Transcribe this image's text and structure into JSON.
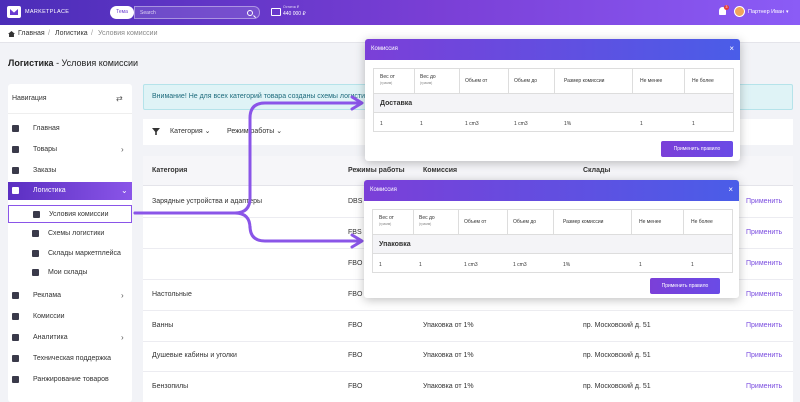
{
  "topbar": {
    "brand": "MARKETPLACE",
    "theme_chip": "Тема",
    "search_placeholder": "Search",
    "balance_label": "Остаток ₽",
    "balance_value": "440 000 ₽",
    "notification_count": "3",
    "user_name": "Партнер Иван",
    "user_caret": "▾"
  },
  "breadcrumbs": {
    "home": "Главная",
    "logistics": "Логистика",
    "current": "Условия комиссии",
    "sep": "/"
  },
  "page_title": {
    "section": "Логистика",
    "rest": " - Условия комиссии"
  },
  "sidebar": {
    "title": "Навигация",
    "toggle_icon": "⇄",
    "chevron": "›",
    "chevron_open": "⌄",
    "items": [
      {
        "label": "Главная"
      },
      {
        "label": "Товары"
      },
      {
        "label": "Заказы"
      },
      {
        "label": "Логистика"
      },
      {
        "label": "Реклама"
      },
      {
        "label": "Комиссии"
      },
      {
        "label": "Аналитика"
      },
      {
        "label": "Техническая поддержка"
      },
      {
        "label": "Ранжирование товаров"
      }
    ],
    "sub_items": [
      {
        "label": "Условия комиссии"
      },
      {
        "label": "Схемы логистики"
      },
      {
        "label": "Склады маркетплейса"
      },
      {
        "label": "Мои склады"
      }
    ]
  },
  "alert": {
    "text": "Внимание! Не для всех категорий товара созданы схемы логистики"
  },
  "filters": {
    "category": "Категория ⌄",
    "modes": "Режим работы ⌄"
  },
  "table": {
    "headers": {
      "category": "Категория",
      "modes": "Режимы работы",
      "commission": "Комиссия",
      "warehouses": "Склады"
    },
    "rows": [
      {
        "category": "Зарядные устройства и адаптеры",
        "mode": "DBS"
      },
      {
        "mode": "FBS"
      },
      {
        "mode": "FBO"
      },
      {
        "category": "Настольные",
        "mode": "FBO"
      },
      {
        "category": "Ванны",
        "mode": "FBO",
        "commission": "Упаковка от 1%",
        "warehouse": "пр. Московский д. 51"
      },
      {
        "category": "Душевые кабины и уголки",
        "mode": "FBO",
        "commission": "Упаковка от 1%",
        "warehouse": "пр. Московский д. 51"
      },
      {
        "category": "Бензопилы",
        "mode": "FBO",
        "commission": "Упаковка от 1%",
        "warehouse": "пр. Московский д. 51"
      }
    ],
    "apply_label": "Применить"
  },
  "modals": [
    {
      "title": "Комиссия",
      "close": "×",
      "headers": [
        "Вес от",
        "Вес до",
        "Объем от",
        "Объем до",
        "Размер комиссии",
        "Не менее",
        "Не более"
      ],
      "header_sub": "(грамм)",
      "section": "Доставка",
      "values": [
        "1",
        "1",
        "1 cm3",
        "1 cm3",
        "1%",
        "1",
        "1"
      ],
      "button": "Применить правило"
    },
    {
      "title": "Комиссия",
      "close": "×",
      "headers": [
        "Вес от",
        "Вес до",
        "Объем от",
        "Объем до",
        "Размер комиссии",
        "Не менее",
        "Не более"
      ],
      "header_sub": "(грамм)",
      "section": "Упаковка",
      "values": [
        "1",
        "1",
        "1 cm3",
        "1 cm3",
        "1%",
        "1",
        "1"
      ],
      "button": "Применить правило"
    }
  ],
  "colors": {
    "accent": "#7b4de0",
    "topbar_start": "#4b2db8",
    "topbar_end": "#8b5cf6",
    "alert_bg": "#dff3f6",
    "connector": "#8a55e8"
  }
}
